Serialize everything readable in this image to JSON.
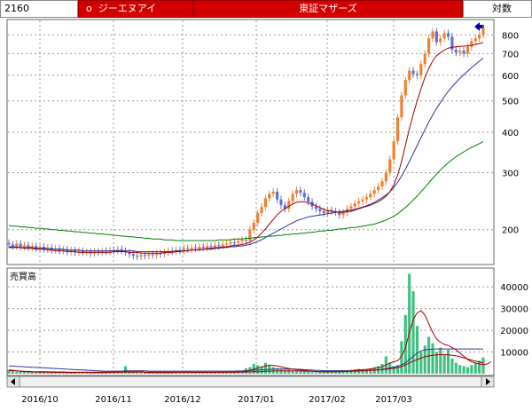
{
  "header": {
    "code": "2160",
    "name_marker": "o",
    "name": "ジーエヌアイ",
    "market": "東証マザーズ",
    "scale": "対数"
  },
  "colors": {
    "header_red": "#d40000",
    "up_candle": "#f08030",
    "down_candle": "#6070d0",
    "ma_short": "#a00000",
    "ma_mid": "#3030a0",
    "ma_long": "#008000",
    "volume": "#40c080",
    "arrow": "#0000c0"
  },
  "icons": {
    "scroll_left": "left-arrow-icon",
    "scroll_right": "right-arrow-icon",
    "latest_marker": "blue-arrow-icon"
  },
  "chart_data": [
    {
      "type": "candlestick",
      "scale": "log",
      "y_ticks": [
        200,
        300,
        400,
        500,
        600,
        700,
        800
      ],
      "ylim": [
        158,
        870
      ],
      "x_tick_labels": [
        "2016/10",
        "2016/11",
        "2016/12",
        "2017/01",
        "2017/02",
        "2017/03"
      ],
      "grid": true,
      "close": [
        180,
        178,
        181,
        177,
        179,
        176,
        178,
        175,
        177,
        174,
        176,
        173,
        175,
        172,
        174,
        171,
        173,
        170,
        172,
        170,
        171,
        169,
        171,
        170,
        172,
        171,
        173,
        172,
        174,
        172,
        170,
        168,
        166,
        165,
        167,
        166,
        168,
        167,
        169,
        168,
        170,
        172,
        171,
        173,
        172,
        175,
        174,
        176,
        175,
        177,
        176,
        178,
        177,
        179,
        178,
        180,
        181,
        183,
        182,
        184,
        186,
        185,
        200,
        210,
        225,
        235,
        250,
        258,
        262,
        248,
        238,
        232,
        245,
        258,
        265,
        260,
        252,
        244,
        236,
        232,
        228,
        225,
        230,
        228,
        226,
        222,
        226,
        232,
        236,
        241,
        245,
        248,
        252,
        258,
        265,
        272,
        282,
        300,
        330,
        375,
        445,
        520,
        580,
        620,
        605,
        600,
        650,
        700,
        780,
        820,
        760,
        780,
        810,
        790,
        720,
        705,
        715,
        700,
        735,
        765,
        780,
        800,
        840
      ],
      "ma_short": [
        176,
        176,
        176,
        176,
        175,
        175,
        175,
        174,
        174,
        174,
        173,
        173,
        172,
        172,
        172,
        171,
        171,
        171,
        170,
        170,
        170,
        170,
        170,
        170,
        170,
        170,
        170,
        171,
        171,
        171,
        171,
        170,
        170,
        170,
        169,
        169,
        169,
        169,
        169,
        169,
        170,
        170,
        170,
        171,
        171,
        172,
        172,
        173,
        173,
        174,
        174,
        175,
        175,
        176,
        176,
        177,
        177,
        178,
        179,
        179,
        180,
        181,
        183,
        186,
        190,
        195,
        201,
        208,
        215,
        222,
        228,
        232,
        236,
        240,
        243,
        244,
        244,
        242,
        240,
        237,
        234,
        231,
        229,
        228,
        227,
        226,
        226,
        227,
        228,
        230,
        232,
        234,
        236,
        238,
        241,
        244,
        248,
        254,
        262,
        275,
        295,
        325,
        365,
        410,
        455,
        500,
        545,
        590,
        630,
        665,
        690,
        705,
        718,
        728,
        732,
        735,
        737,
        738,
        740,
        743,
        747,
        752,
        758
      ],
      "ma_mid": [
        177,
        177,
        177,
        176,
        176,
        176,
        176,
        175,
        175,
        175,
        175,
        174,
        174,
        174,
        174,
        173,
        173,
        173,
        173,
        172,
        172,
        172,
        172,
        172,
        172,
        172,
        172,
        172,
        172,
        172,
        172,
        172,
        172,
        171,
        171,
        171,
        171,
        171,
        171,
        171,
        171,
        171,
        171,
        172,
        172,
        172,
        172,
        173,
        173,
        173,
        174,
        174,
        174,
        175,
        175,
        176,
        176,
        177,
        177,
        178,
        178,
        179,
        180,
        182,
        184,
        186,
        189,
        192,
        195,
        198,
        201,
        204,
        207,
        210,
        213,
        215,
        217,
        219,
        220,
        221,
        222,
        223,
        224,
        225,
        226,
        227,
        228,
        229,
        230,
        231,
        233,
        235,
        237,
        240,
        243,
        247,
        251,
        256,
        262,
        270,
        280,
        293,
        308,
        325,
        344,
        364,
        385,
        407,
        430,
        452,
        474,
        495,
        515,
        535,
        553,
        570,
        587,
        603,
        618,
        633,
        648,
        663,
        678
      ],
      "ma_long": [
        206,
        205,
        205,
        204,
        204,
        203,
        203,
        202,
        202,
        201,
        201,
        200,
        200,
        199,
        199,
        198,
        198,
        197,
        197,
        196,
        196,
        195,
        195,
        194,
        194,
        193,
        193,
        192,
        192,
        191,
        191,
        190,
        190,
        189,
        189,
        188,
        188,
        187,
        187,
        187,
        186,
        186,
        186,
        185,
        185,
        185,
        185,
        185,
        185,
        185,
        185,
        185,
        185,
        185,
        186,
        186,
        186,
        186,
        187,
        187,
        187,
        188,
        188,
        189,
        189,
        190,
        190,
        191,
        191,
        192,
        192,
        193,
        193,
        194,
        194,
        195,
        195,
        196,
        196,
        197,
        198,
        198,
        199,
        199,
        200,
        201,
        201,
        202,
        203,
        203,
        204,
        205,
        206,
        207,
        208,
        210,
        212,
        214,
        217,
        220,
        224,
        229,
        234,
        240,
        247,
        254,
        262,
        270,
        279,
        288,
        297,
        306,
        314,
        322,
        329,
        336,
        342,
        348,
        354,
        359,
        364,
        369,
        374
      ]
    },
    {
      "type": "bar",
      "label": "売買高",
      "y_ticks": [
        10000,
        20000,
        30000,
        40000
      ],
      "ylim": [
        0,
        47000
      ],
      "values": [
        1800,
        1200,
        900,
        1000,
        800,
        900,
        700,
        800,
        600,
        700,
        800,
        600,
        500,
        700,
        600,
        500,
        600,
        500,
        700,
        800,
        600,
        500,
        400,
        600,
        500,
        700,
        900,
        1200,
        600,
        500,
        3500,
        700,
        600,
        500,
        400,
        500,
        600,
        500,
        400,
        500,
        600,
        700,
        500,
        600,
        800,
        700,
        600,
        500,
        600,
        700,
        600,
        500,
        600,
        700,
        800,
        600,
        700,
        800,
        900,
        1200,
        1000,
        2500,
        3000,
        4500,
        4000,
        3500,
        5000,
        3800,
        3000,
        2500,
        2000,
        1800,
        2000,
        1500,
        1200,
        1000,
        900,
        800,
        700,
        600,
        800,
        700,
        900,
        1000,
        800,
        900,
        1200,
        1500,
        1800,
        2000,
        2200,
        1500,
        1800,
        2500,
        3000,
        3500,
        4500,
        8000,
        5000,
        3500,
        4000,
        15000,
        27000,
        46000,
        38000,
        22000,
        10000,
        13000,
        17000,
        14000,
        10000,
        12000,
        9000,
        11000,
        7000,
        5000,
        4000,
        3500,
        3000,
        4000,
        5000,
        6000,
        7500
      ],
      "ma_short": [
        1800,
        1600,
        1400,
        1200,
        1000,
        900,
        800,
        800,
        750,
        700,
        700,
        650,
        600,
        600,
        600,
        550,
        550,
        550,
        600,
        600,
        600,
        550,
        500,
        500,
        500,
        550,
        600,
        700,
        700,
        700,
        1100,
        1100,
        1100,
        1100,
        1100,
        600,
        550,
        500,
        500,
        500,
        500,
        550,
        550,
        600,
        600,
        650,
        650,
        600,
        600,
        600,
        600,
        600,
        600,
        600,
        650,
        650,
        700,
        700,
        750,
        800,
        900,
        1200,
        1600,
        2100,
        2600,
        3000,
        3500,
        4000,
        3800,
        3600,
        3200,
        2800,
        2400,
        2100,
        1900,
        1700,
        1500,
        1300,
        1100,
        1000,
        900,
        850,
        850,
        900,
        900,
        950,
        1000,
        1100,
        1300,
        1500,
        1700,
        1900,
        2000,
        2200,
        2500,
        2800,
        3200,
        4000,
        5000,
        5500,
        6000,
        8000,
        12000,
        19000,
        25000,
        28000,
        29000,
        27000,
        23000,
        19000,
        16000,
        14500,
        13500,
        13000,
        12000,
        11000,
        9500,
        8000,
        6500,
        5500,
        5000,
        4500,
        4200,
        4500,
        5500
      ],
      "ma_long": [
        1500,
        1400,
        1300,
        1200,
        1100,
        1050,
        1000,
        950,
        900,
        900,
        850,
        850,
        800,
        800,
        800,
        750,
        750,
        750,
        750,
        750,
        700,
        700,
        700,
        700,
        700,
        700,
        700,
        700,
        700,
        700,
        750,
        750,
        750,
        750,
        750,
        750,
        700,
        700,
        700,
        700,
        700,
        700,
        700,
        700,
        700,
        700,
        700,
        700,
        700,
        700,
        700,
        700,
        700,
        700,
        700,
        700,
        700,
        700,
        720,
        740,
        760,
        800,
        850,
        900,
        950,
        1000,
        1100,
        1200,
        1250,
        1300,
        1300,
        1300,
        1300,
        1300,
        1300,
        1250,
        1200,
        1150,
        1100,
        1050,
        1000,
        1000,
        1000,
        1000,
        1000,
        1000,
        1050,
        1100,
        1150,
        1200,
        1250,
        1300,
        1400,
        1500,
        1600,
        1700,
        1900,
        2100,
        2300,
        2500,
        2800,
        3300,
        4000,
        5000,
        5800,
        6500,
        7200,
        7800,
        8200,
        8500,
        8700,
        8800,
        8800,
        8700,
        8500,
        8200,
        7800,
        7300,
        6800,
        6300,
        5800,
        5400,
        5000
      ],
      "mid_series": [
        3500,
        3500,
        3400,
        3300,
        3200,
        3100,
        3000,
        2900,
        2800,
        2700,
        2600,
        2500,
        2400,
        2300,
        2200,
        2100,
        2000,
        1900,
        1800,
        1700,
        1600,
        1500,
        1400,
        1300,
        1200,
        1200,
        1200,
        1200,
        1200,
        1200,
        1300,
        1300,
        1300,
        1300,
        1300,
        1300,
        1200,
        1200,
        1200,
        1200,
        1200,
        1200,
        1200,
        1200,
        1200,
        1200,
        1200,
        1200,
        1200,
        1200,
        1200,
        1200,
        1200,
        1200,
        1200,
        1200,
        1200,
        1200,
        1200,
        1250,
        1300,
        1400,
        1500,
        1600,
        1700,
        1800,
        1900,
        2000,
        2100,
        2200,
        2200,
        2200,
        2200,
        2200,
        2100,
        2000,
        1900,
        1800,
        1700,
        1600,
        1500,
        1400,
        1400,
        1400,
        1400,
        1400,
        1400,
        1400,
        1400,
        1400,
        1400,
        1400,
        1500,
        1600,
        1700,
        1800,
        2000,
        2300,
        2700,
        3000,
        3400,
        4000,
        5000,
        6500,
        8000,
        9500,
        10500,
        11000,
        11200,
        11300,
        11400,
        11400,
        11400,
        11400,
        11400,
        11400,
        11400,
        11400,
        11400,
        11400,
        11400,
        11400,
        11400
      ]
    }
  ]
}
